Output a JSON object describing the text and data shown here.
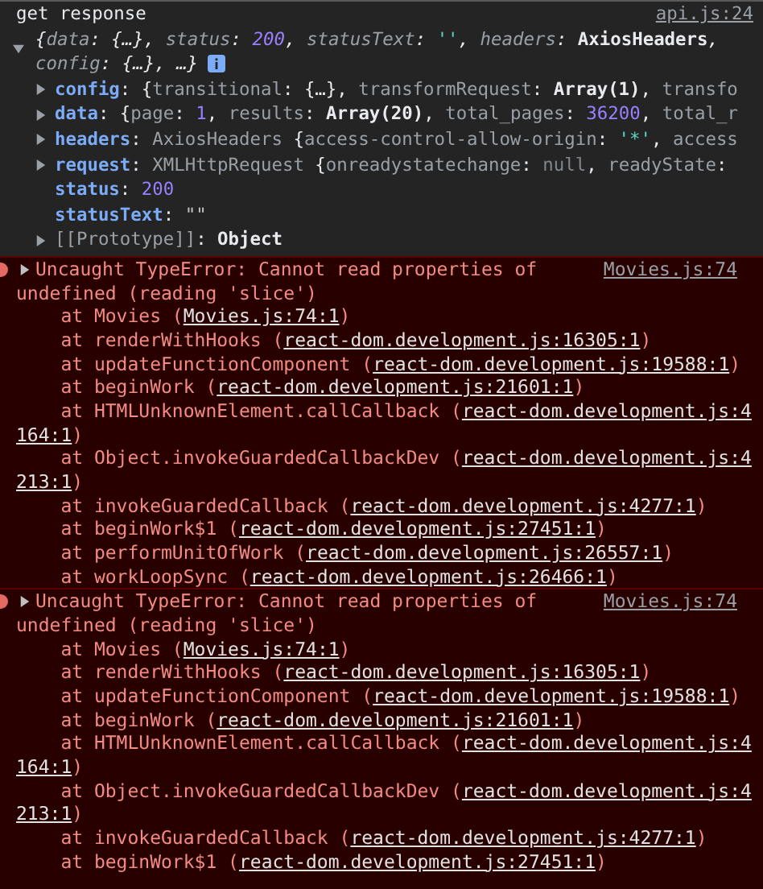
{
  "log": {
    "message": "get response",
    "source": "api.js:24",
    "expanded": true,
    "summary_lines": [
      [
        {
          "kind": "punct",
          "text": "{"
        },
        {
          "kind": "key",
          "text": "data"
        },
        {
          "kind": "punct",
          "text": ": {…}, "
        },
        {
          "kind": "key",
          "text": "status"
        },
        {
          "kind": "punct",
          "text": ": "
        },
        {
          "kind": "num",
          "text": "200"
        },
        {
          "kind": "punct",
          "text": ", "
        },
        {
          "kind": "key",
          "text": "statusText"
        },
        {
          "kind": "punct",
          "text": ": "
        },
        {
          "kind": "str",
          "text": "''"
        },
        {
          "kind": "punct",
          "text": ", "
        },
        {
          "kind": "key",
          "text": "headers"
        },
        {
          "kind": "punct",
          "text": ": "
        },
        {
          "kind": "type",
          "text": "AxiosHeaders"
        },
        {
          "kind": "punct",
          "text": ","
        }
      ],
      [
        {
          "kind": "key",
          "text": "config"
        },
        {
          "kind": "punct",
          "text": ": {…}, …}"
        }
      ]
    ],
    "properties": [
      {
        "name": "config",
        "kind": "own",
        "expandable": true,
        "value": [
          {
            "kind": "punct",
            "text": ": {"
          },
          {
            "kind": "key",
            "text": "transitional"
          },
          {
            "kind": "punct",
            "text": ": {…}, "
          },
          {
            "kind": "key",
            "text": "transformRequest"
          },
          {
            "kind": "punct",
            "text": ": "
          },
          {
            "kind": "type",
            "text": "Array(1)"
          },
          {
            "kind": "punct",
            "text": ", "
          },
          {
            "kind": "key",
            "text": "transfo"
          }
        ]
      },
      {
        "name": "data",
        "kind": "own",
        "expandable": true,
        "value": [
          {
            "kind": "punct",
            "text": ": {"
          },
          {
            "kind": "key",
            "text": "page"
          },
          {
            "kind": "punct",
            "text": ": "
          },
          {
            "kind": "num",
            "text": "1"
          },
          {
            "kind": "punct",
            "text": ", "
          },
          {
            "kind": "key",
            "text": "results"
          },
          {
            "kind": "punct",
            "text": ": "
          },
          {
            "kind": "type",
            "text": "Array(20)"
          },
          {
            "kind": "punct",
            "text": ", "
          },
          {
            "kind": "key",
            "text": "total_pages"
          },
          {
            "kind": "punct",
            "text": ": "
          },
          {
            "kind": "num",
            "text": "36200"
          },
          {
            "kind": "punct",
            "text": ", "
          },
          {
            "kind": "key",
            "text": "total_r"
          }
        ]
      },
      {
        "name": "headers",
        "kind": "own",
        "expandable": true,
        "value": [
          {
            "kind": "punct",
            "text": ": "
          },
          {
            "kind": "class",
            "text": "AxiosHeaders"
          },
          {
            "kind": "punct",
            "text": " {"
          },
          {
            "kind": "key",
            "text": "access-control-allow-origin"
          },
          {
            "kind": "punct",
            "text": ": "
          },
          {
            "kind": "str",
            "text": "'*'"
          },
          {
            "kind": "punct",
            "text": ", "
          },
          {
            "kind": "key",
            "text": "access"
          }
        ]
      },
      {
        "name": "request",
        "kind": "own",
        "expandable": true,
        "value": [
          {
            "kind": "punct",
            "text": ": "
          },
          {
            "kind": "class",
            "text": "XMLHttpRequest"
          },
          {
            "kind": "punct",
            "text": " {"
          },
          {
            "kind": "key",
            "text": "onreadystatechange"
          },
          {
            "kind": "punct",
            "text": ": "
          },
          {
            "kind": "null",
            "text": "null"
          },
          {
            "kind": "punct",
            "text": ", "
          },
          {
            "kind": "key",
            "text": "readyState"
          },
          {
            "kind": "punct",
            "text": ":"
          }
        ]
      },
      {
        "name": "status",
        "kind": "own",
        "expandable": false,
        "value": [
          {
            "kind": "punct",
            "text": ": "
          },
          {
            "kind": "num",
            "text": "200"
          }
        ]
      },
      {
        "name": "statusText",
        "kind": "own",
        "expandable": false,
        "value": [
          {
            "kind": "punct",
            "text": ": "
          },
          {
            "kind": "plainstr",
            "text": "\"\""
          }
        ]
      },
      {
        "name": "[[Prototype]]",
        "kind": "internal",
        "expandable": true,
        "value": [
          {
            "kind": "punct",
            "text": ": "
          },
          {
            "kind": "type",
            "text": "Object"
          }
        ]
      }
    ]
  },
  "errors": [
    {
      "message_lines": [
        "Uncaught TypeError: Cannot read properties of",
        "undefined (reading 'slice')"
      ],
      "source": "Movies.js:74",
      "expanded": false,
      "frames": [
        {
          "call": "at Movies (",
          "link": [
            "Movies.js:74:1"
          ],
          "close": ")"
        },
        {
          "call": "at renderWithHooks (",
          "link": [
            "react-dom.development.js:16305:1"
          ],
          "close": ")"
        },
        {
          "call": "at updateFunctionComponent (",
          "link": [
            "react-dom.development.js:19588:1"
          ],
          "close": ")"
        },
        {
          "call": "at beginWork (",
          "link": [
            "react-dom.development.js:21601:1"
          ],
          "close": ")"
        },
        {
          "call": "at HTMLUnknownElement.callCallback (",
          "link": [
            "react-dom.development.js:4",
            "164:1"
          ],
          "close": ")"
        },
        {
          "call": "at Object.invokeGuardedCallbackDev (",
          "link": [
            "react-dom.development.js:4",
            "213:1"
          ],
          "close": ")"
        },
        {
          "call": "at invokeGuardedCallback (",
          "link": [
            "react-dom.development.js:4277:1"
          ],
          "close": ")"
        },
        {
          "call": "at beginWork$1 (",
          "link": [
            "react-dom.development.js:27451:1"
          ],
          "close": ")"
        },
        {
          "call": "at performUnitOfWork (",
          "link": [
            "react-dom.development.js:26557:1"
          ],
          "close": ")"
        },
        {
          "call": "at workLoopSync (",
          "link": [
            "react-dom.development.js:26466:1"
          ],
          "close": ")"
        }
      ]
    },
    {
      "message_lines": [
        "Uncaught TypeError: Cannot read properties of",
        "undefined (reading 'slice')"
      ],
      "source": "Movies.js:74",
      "expanded": false,
      "frames": [
        {
          "call": "at Movies (",
          "link": [
            "Movies.js:74:1"
          ],
          "close": ")"
        },
        {
          "call": "at renderWithHooks (",
          "link": [
            "react-dom.development.js:16305:1"
          ],
          "close": ")"
        },
        {
          "call": "at updateFunctionComponent (",
          "link": [
            "react-dom.development.js:19588:1"
          ],
          "close": ")"
        },
        {
          "call": "at beginWork (",
          "link": [
            "react-dom.development.js:21601:1"
          ],
          "close": ")"
        },
        {
          "call": "at HTMLUnknownElement.callCallback (",
          "link": [
            "react-dom.development.js:4",
            "164:1"
          ],
          "close": ")"
        },
        {
          "call": "at Object.invokeGuardedCallbackDev (",
          "link": [
            "react-dom.development.js:4",
            "213:1"
          ],
          "close": ")"
        },
        {
          "call": "at invokeGuardedCallback (",
          "link": [
            "react-dom.development.js:4277:1"
          ],
          "close": ")"
        },
        {
          "call": "at beginWork$1 (",
          "link": [
            "react-dom.development.js:27451:1"
          ],
          "close": ")"
        }
      ]
    }
  ]
}
